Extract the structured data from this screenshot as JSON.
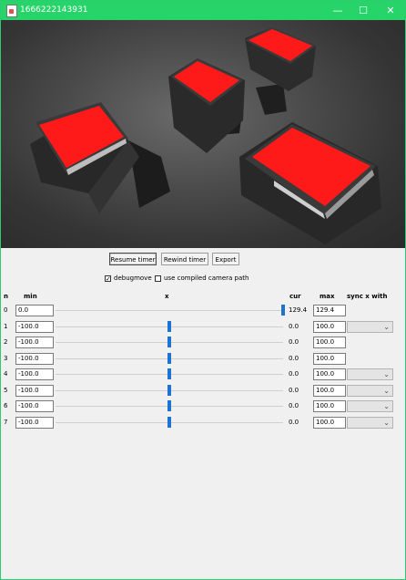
{
  "window": {
    "title": "1666222143931",
    "minimize": "—",
    "maximize": "☐",
    "close": "✕"
  },
  "controls": {
    "resume_label": "Resume timer",
    "rewind_label": "Rewind timer",
    "export_label": "Export",
    "debugmove_label": "debugmove",
    "debugmove_checked": true,
    "compiled_label": "use compiled camera path",
    "compiled_checked": false
  },
  "table": {
    "headers": {
      "n": "n",
      "min": "min",
      "x": "x",
      "cur": "cur",
      "max": "max",
      "sync": "sync x with"
    },
    "rows": [
      {
        "n": "0",
        "min": "0.0",
        "cur": "129.4",
        "max": "129.4",
        "slider_fraction": 1.0,
        "has_sync": false
      },
      {
        "n": "1",
        "min": "-100.0",
        "cur": "0.0",
        "max": "100.0",
        "slider_fraction": 0.5,
        "has_sync": true
      },
      {
        "n": "2",
        "min": "-100.0",
        "cur": "0.0",
        "max": "100.0",
        "slider_fraction": 0.5,
        "has_sync": false
      },
      {
        "n": "3",
        "min": "-100.0",
        "cur": "0.0",
        "max": "100.0",
        "slider_fraction": 0.5,
        "has_sync": false
      },
      {
        "n": "4",
        "min": "-100.0",
        "cur": "0.0",
        "max": "100.0",
        "slider_fraction": 0.5,
        "has_sync": true
      },
      {
        "n": "5",
        "min": "-100.0",
        "cur": "0.0",
        "max": "100.0",
        "slider_fraction": 0.5,
        "has_sync": true
      },
      {
        "n": "6",
        "min": "-100.0",
        "cur": "0.0",
        "max": "100.0",
        "slider_fraction": 0.5,
        "has_sync": true
      },
      {
        "n": "7",
        "min": "-100.0",
        "cur": "0.0",
        "max": "100.0",
        "slider_fraction": 0.5,
        "has_sync": true
      }
    ]
  },
  "colors": {
    "title_bar": "#27d46a",
    "cube_top": "#ff1a1a",
    "slider_thumb": "#1e73d1"
  }
}
